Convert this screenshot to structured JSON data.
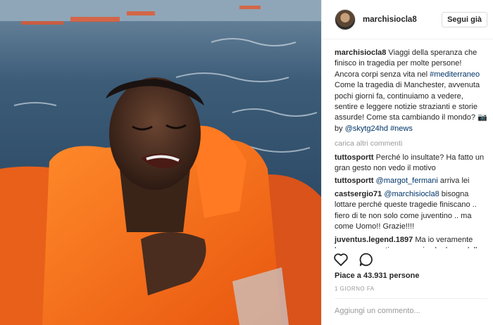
{
  "post": {
    "username": "marchisiocla8",
    "follow_label": "Segui già",
    "caption": {
      "user": "marchisiocla8",
      "text1": " Viaggi della speranza che finisco in tragedia per molte persone! Ancora corpi senza vita nel ",
      "hashtag1": "#mediterraneo",
      "text2": " Come la tragedia di Manchester, avvenuta pochi giorni fa, continuiamo a vedere, sentire e leggere notizie strazianti e storie assurde! Come sta cambiando il mondo? 📷 by ",
      "mention": "@skytg24hd",
      "text3": " ",
      "hashtag2": "#news"
    },
    "load_more": "carica altri commenti",
    "comments": [
      {
        "user": "tuttosportt",
        "pre": " Perché lo insultate? Ha fatto un gran gesto non vedo il motivo",
        "mention": "",
        "post": ""
      },
      {
        "user": "tuttosportt",
        "pre": " ",
        "mention": "@margot_fermani",
        "post": " arriva lei"
      },
      {
        "user": "castsergio71",
        "pre": " ",
        "mention": "@marchisiocla8",
        "post": " bisogna lottare perché queste tragedie finiscano .. fiero di te non solo come juventino .. ma come Uomo!! Grazie!!!!"
      },
      {
        "user": "juventus.legend.1897",
        "pre": " Ma io veramente leggo commenti, cose serie che bene dell",
        "mention": "",
        "post": ""
      }
    ],
    "likes_label": "Piace a 43.931 persone",
    "time_label": "1 GIORNO FA",
    "comment_placeholder": "Aggiungi un commento...",
    "icons": [
      "heart-icon",
      "comment-icon"
    ]
  },
  "colors": {
    "link": "#003569",
    "muted": "#999999",
    "text": "#262626",
    "lifejacket": "#f26a1b"
  }
}
